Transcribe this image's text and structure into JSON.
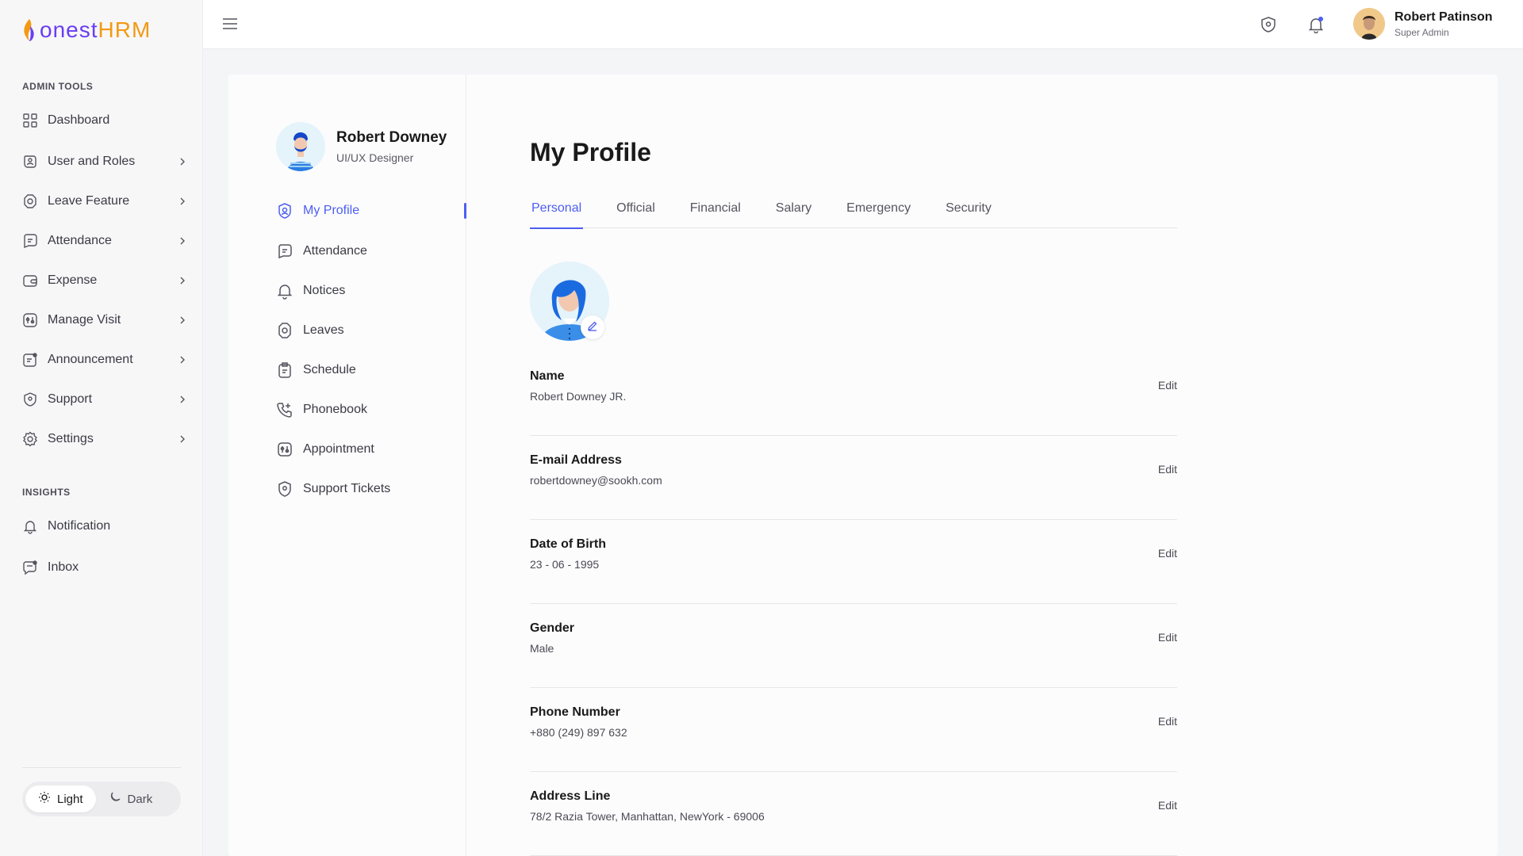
{
  "brand": {
    "name_part1": "onest",
    "name_part2": "HRM",
    "primary_color": "#6a3df5",
    "accent_color": "#f29a13"
  },
  "sidebar": {
    "section_admin": "ADMIN TOOLS",
    "items": [
      {
        "label": "Dashboard",
        "icon": "grid-icon",
        "has_chevron": false
      },
      {
        "label": "User and Roles",
        "icon": "users-icon",
        "has_chevron": true
      },
      {
        "label": "Leave Feature",
        "icon": "leave-icon",
        "has_chevron": true
      },
      {
        "label": "Attendance",
        "icon": "attendance-icon",
        "has_chevron": true
      },
      {
        "label": "Expense",
        "icon": "wallet-icon",
        "has_chevron": true
      },
      {
        "label": "Manage Visit",
        "icon": "visit-icon",
        "has_chevron": true
      },
      {
        "label": "Announcement",
        "icon": "announcement-icon",
        "has_chevron": true
      },
      {
        "label": "Support",
        "icon": "shield-icon",
        "has_chevron": true
      },
      {
        "label": "Settings",
        "icon": "gear-icon",
        "has_chevron": true
      }
    ],
    "section_insights": "INSIGHTS",
    "insights": [
      {
        "label": "Notification",
        "icon": "bell-icon"
      },
      {
        "label": "Inbox",
        "icon": "inbox-icon"
      }
    ],
    "theme": {
      "light": "Light",
      "dark": "Dark",
      "selected": "Light"
    }
  },
  "header": {
    "user_name": "Robert Patinson",
    "user_role": "Super Admin"
  },
  "profile_nav": {
    "name": "Robert Downey",
    "title": "UI/UX Designer",
    "items": [
      {
        "label": "My Profile",
        "icon": "profile-icon",
        "active": true
      },
      {
        "label": "Attendance",
        "icon": "attendance-icon",
        "active": false
      },
      {
        "label": "Notices",
        "icon": "bell-icon",
        "active": false
      },
      {
        "label": "Leaves",
        "icon": "leave-icon",
        "active": false
      },
      {
        "label": "Schedule",
        "icon": "clipboard-icon",
        "active": false
      },
      {
        "label": "Phonebook",
        "icon": "phone-icon",
        "active": false
      },
      {
        "label": "Appointment",
        "icon": "appointment-icon",
        "active": false
      },
      {
        "label": "Support Tickets",
        "icon": "shield-icon",
        "active": false
      }
    ]
  },
  "main": {
    "title": "My Profile",
    "tabs": [
      {
        "label": "Personal",
        "active": true
      },
      {
        "label": "Official",
        "active": false
      },
      {
        "label": "Financial",
        "active": false
      },
      {
        "label": "Salary",
        "active": false
      },
      {
        "label": "Emergency",
        "active": false
      },
      {
        "label": "Security",
        "active": false
      }
    ],
    "edit_label": "Edit",
    "fields": [
      {
        "label": "Name",
        "value": "Robert Downey JR."
      },
      {
        "label": "E-mail Address",
        "value": "robertdowney@sookh.com"
      },
      {
        "label": "Date of Birth",
        "value": "23 - 06 - 1995"
      },
      {
        "label": "Gender",
        "value": "Male"
      },
      {
        "label": "Phone Number",
        "value": "+880 (249) 897 632"
      },
      {
        "label": "Address Line",
        "value": "78/2 Razia Tower, Manhattan, NewYork - 69006"
      }
    ]
  },
  "colors": {
    "active": "#4d5ef0",
    "text": "#1a1a1a",
    "muted": "#4a4a54"
  }
}
